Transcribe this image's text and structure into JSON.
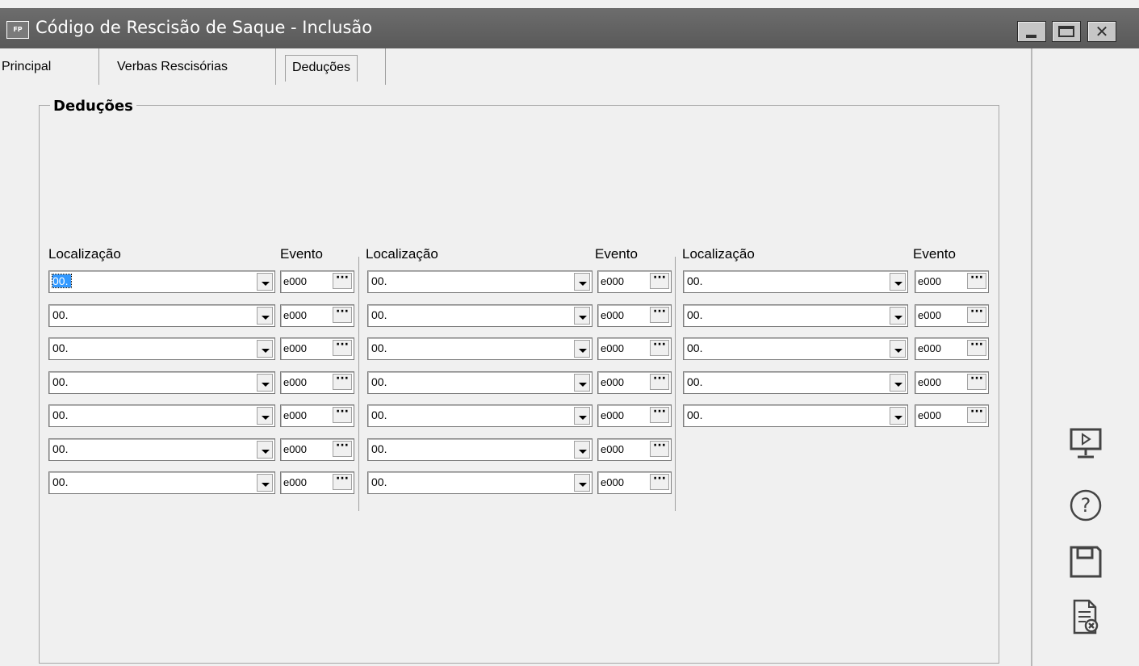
{
  "window": {
    "app_icon_label": "FP",
    "title": "Código de Rescisão de Saque - Inclusão",
    "close_glyph": "✕"
  },
  "tabs": [
    {
      "label": "Principal",
      "active": false
    },
    {
      "label": "Verbas Rescisórias",
      "active": false
    },
    {
      "label": "Deduções",
      "active": true
    }
  ],
  "group": {
    "title": "Deduções"
  },
  "columns": [
    {
      "loc_header": "Localização",
      "event_header": "Evento",
      "rows": [
        {
          "loc": "00.",
          "event": "e000",
          "selected": true
        },
        {
          "loc": "00.",
          "event": "e000"
        },
        {
          "loc": "00.",
          "event": "e000"
        },
        {
          "loc": "00.",
          "event": "e000"
        },
        {
          "loc": "00.",
          "event": "e000"
        },
        {
          "loc": "00.",
          "event": "e000"
        },
        {
          "loc": "00.",
          "event": "e000"
        }
      ]
    },
    {
      "loc_header": "Localização",
      "event_header": "Evento",
      "rows": [
        {
          "loc": "00.",
          "event": "e000"
        },
        {
          "loc": "00.",
          "event": "e000"
        },
        {
          "loc": "00.",
          "event": "e000"
        },
        {
          "loc": "00.",
          "event": "e000"
        },
        {
          "loc": "00.",
          "event": "e000"
        },
        {
          "loc": "00.",
          "event": "e000"
        },
        {
          "loc": "00.",
          "event": "e000"
        }
      ]
    },
    {
      "loc_header": "Localização",
      "event_header": "Evento",
      "rows": [
        {
          "loc": "00.",
          "event": "e000"
        },
        {
          "loc": "00.",
          "event": "e000"
        },
        {
          "loc": "00.",
          "event": "e000"
        },
        {
          "loc": "00.",
          "event": "e000"
        },
        {
          "loc": "00.",
          "event": "e000"
        }
      ]
    }
  ],
  "event_button_glyph": "···",
  "side_icons": [
    "presentation-icon",
    "help-icon",
    "save-icon",
    "cancel-document-icon"
  ],
  "help_glyph": "?"
}
